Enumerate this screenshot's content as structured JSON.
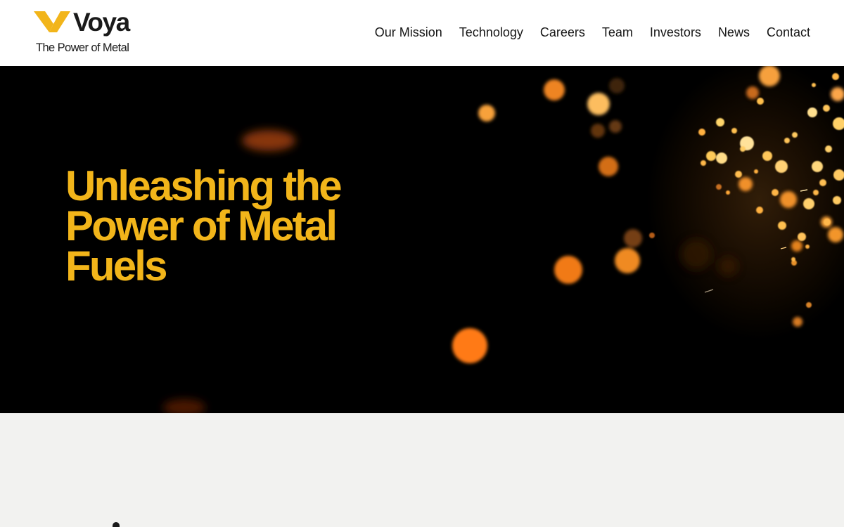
{
  "header": {
    "logo": {
      "name": "Voya",
      "tagline": "The Power of Metal",
      "mark_color": "#f2b51a"
    },
    "nav": [
      {
        "label": "Our Mission"
      },
      {
        "label": "Technology"
      },
      {
        "label": "Careers"
      },
      {
        "label": "Team"
      },
      {
        "label": "Investors"
      },
      {
        "label": "News"
      },
      {
        "label": "Contact"
      }
    ]
  },
  "hero": {
    "title": "Unleashing the Power of Metal Fuels",
    "title_color": "#f2b51a",
    "background": "glowing orange sparks on black"
  },
  "colors": {
    "accent": "#f2b51a",
    "header_bg": "#ffffff",
    "hero_bg": "#000000",
    "section_bg": "#f2f2f0",
    "text": "#161616"
  }
}
